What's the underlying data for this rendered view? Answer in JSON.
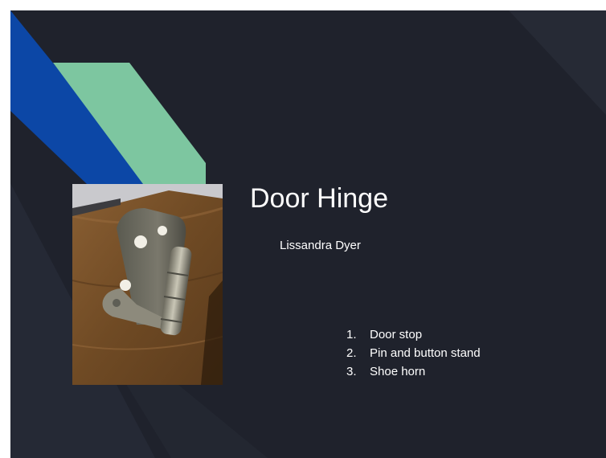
{
  "slide": {
    "title": "Door Hinge",
    "author": "Lissandra Dyer",
    "list_items": [
      {
        "number": "1.",
        "text": "Door stop"
      },
      {
        "number": "2.",
        "text": "Pin and button stand"
      },
      {
        "number": "3.",
        "text": "Shoe horn"
      }
    ],
    "image": {
      "icon": "door-hinge-photo"
    }
  },
  "colors": {
    "background": "#1f222c",
    "accent_blue": "#0c47a6",
    "accent_green": "#7dc6a0",
    "text": "#ffffff"
  }
}
